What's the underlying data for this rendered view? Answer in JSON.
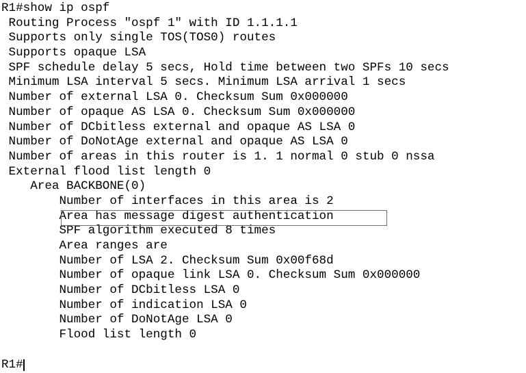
{
  "terminal": {
    "command_line": "R1#show ip ospf",
    "output_lines": [
      " Routing Process \"ospf 1\" with ID 1.1.1.1",
      " Supports only single TOS(TOS0) routes",
      " Supports opaque LSA",
      " SPF schedule delay 5 secs, Hold time between two SPFs 10 secs",
      " Minimum LSA interval 5 secs. Minimum LSA arrival 1 secs",
      " Number of external LSA 0. Checksum Sum 0x000000",
      " Number of opaque AS LSA 0. Checksum Sum 0x000000",
      " Number of DCbitless external and opaque AS LSA 0",
      " Number of DoNotAge external and opaque AS LSA 0",
      " Number of areas in this router is 1. 1 normal 0 stub 0 nssa",
      " External flood list length 0",
      "    Area BACKBONE(0)",
      "        Number of interfaces in this area is 2",
      "        Area has message digest authentication",
      "        SPF algorithm executed 8 times",
      "        Area ranges are",
      "        Number of LSA 2. Checksum Sum 0x00f68d",
      "        Number of opaque link LSA 0. Checksum Sum 0x000000",
      "        Number of DCbitless LSA 0",
      "        Number of indication LSA 0",
      "        Number of DoNotAge LSA 0",
      "        Flood list length 0"
    ],
    "final_prompt": "R1#",
    "highlight": {
      "text": "Area has message digest authentication",
      "color": "#c94a4a"
    },
    "colors": {
      "background": "#ffffff",
      "foreground": "#000000",
      "annotation": "#c94a4a"
    }
  }
}
